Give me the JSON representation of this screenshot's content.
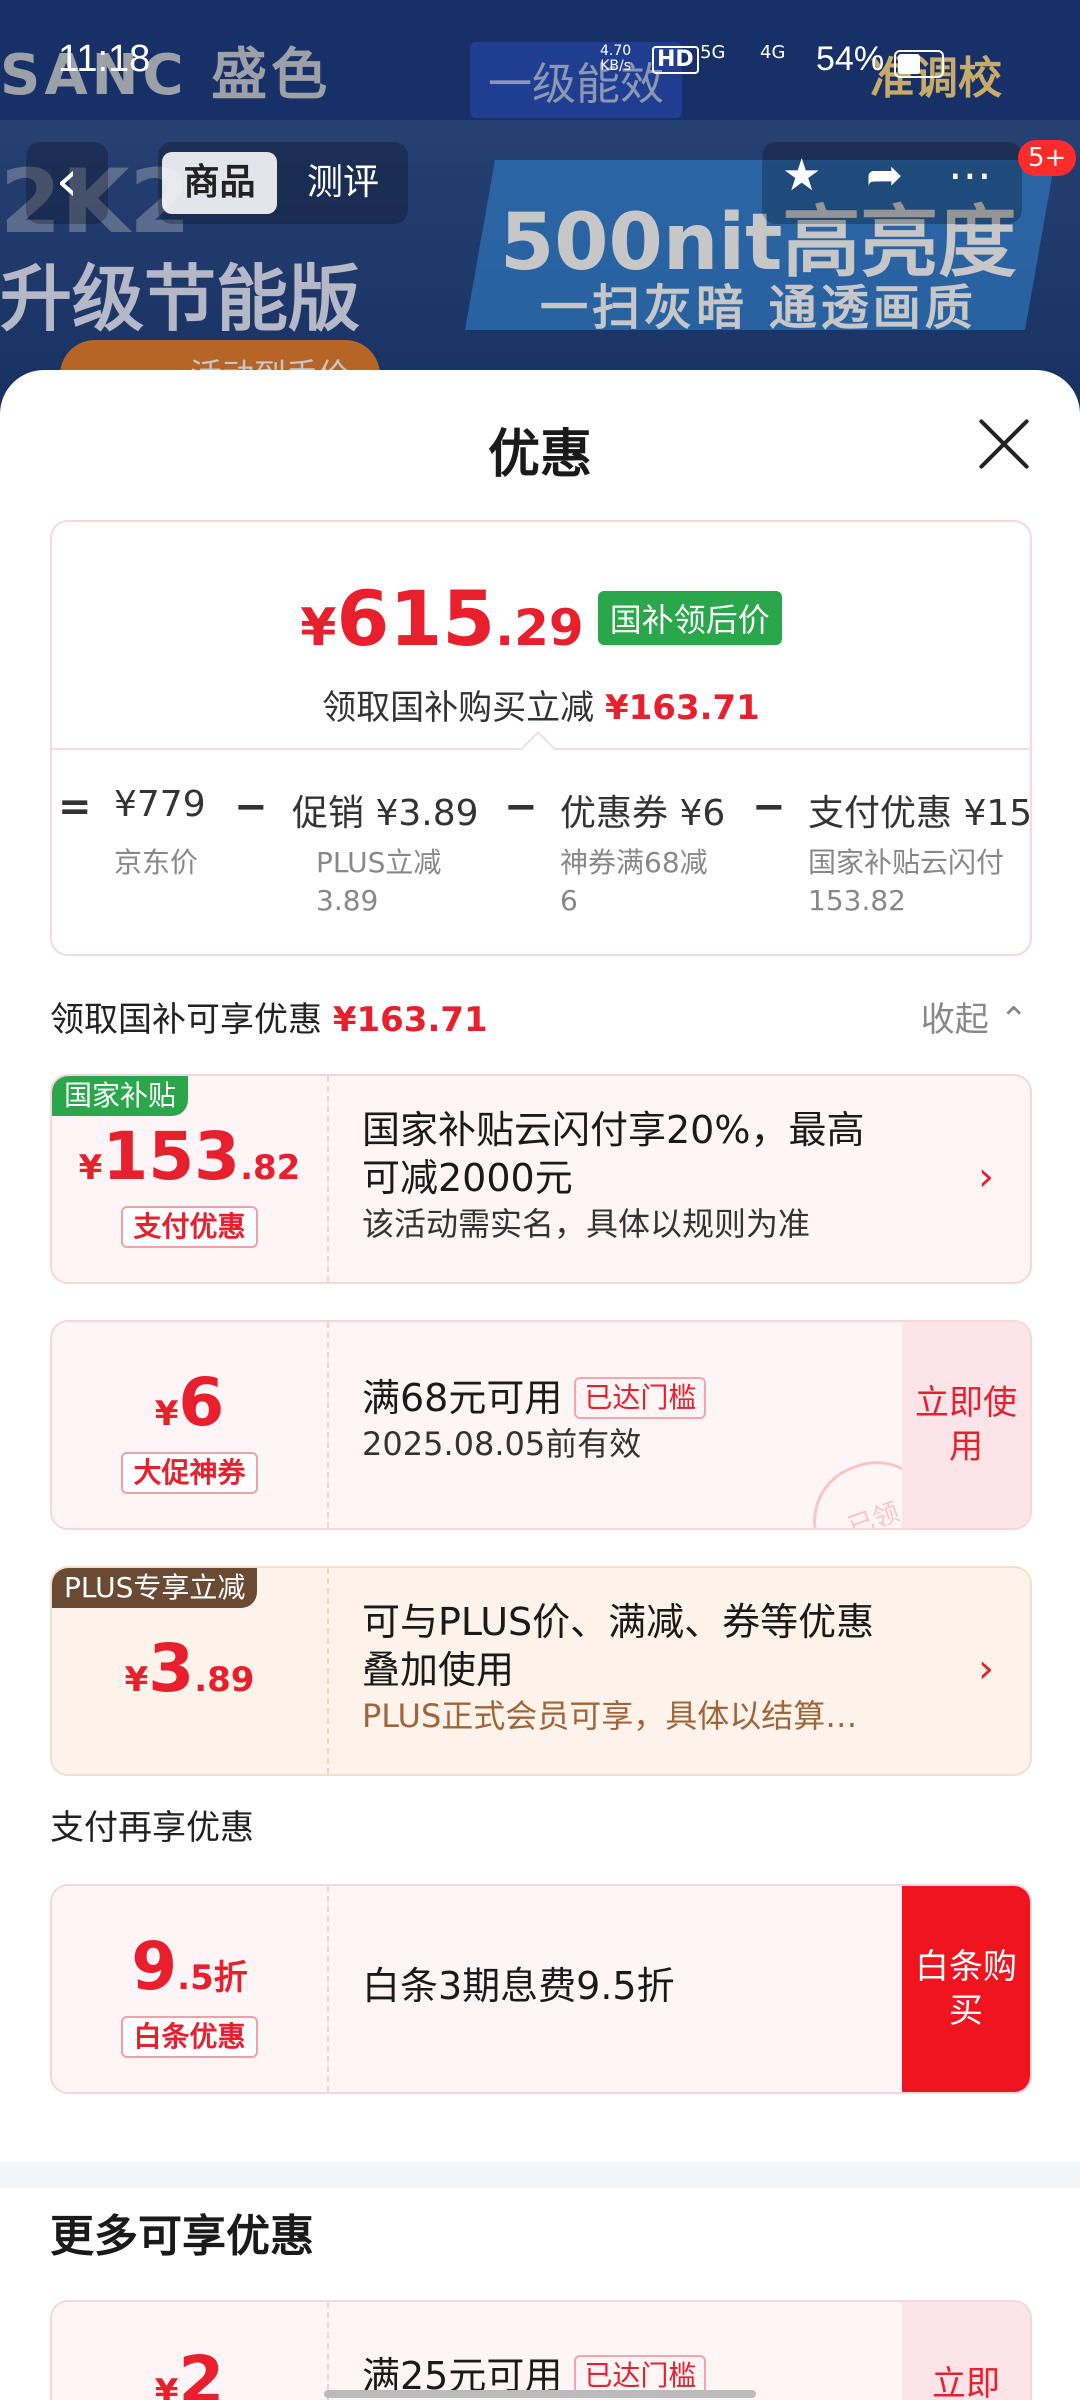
{
  "status_bar": {
    "time": "11:18",
    "net_speed": "4.70",
    "net_unit": "KB/s",
    "hd": "HD",
    "signal1": "5G",
    "signal2": "4G",
    "battery": "54%"
  },
  "banner": {
    "brand": "SANC 盛色",
    "tag_energy": "一级能效",
    "tag_calib": "准调校",
    "left_text": "2K2",
    "left_text2": "升级节能版",
    "right_text": "500nit高亮度",
    "right_text2": "一扫灰暗 通透画质",
    "promo": "活动到手价"
  },
  "nav": {
    "back_icon": "‹",
    "tab_active": "商品",
    "tab_other": "测评",
    "badge": "5+"
  },
  "sheet": {
    "title": "优惠",
    "price": {
      "currency": "¥",
      "integer": "615",
      "decimal": ".29",
      "tag": "国补领后价",
      "subtitle": "领取国补购买立减",
      "subtitle_amount": "¥163.71"
    },
    "calc": {
      "eq": "=",
      "items": [
        {
          "value": "¥779",
          "label": "京东价",
          "label2": ""
        },
        {
          "value": "促销 ¥3.89",
          "label": "PLUS立减",
          "label2": "3.89"
        },
        {
          "value": "优惠券 ¥6",
          "label": "神券满68减",
          "label2": "6"
        },
        {
          "value": "支付优惠 ¥15",
          "label": "国家补贴云闪付",
          "label2": "153.82"
        }
      ],
      "op": "−"
    },
    "section1": {
      "label": "领取国补可享优惠",
      "amount": "¥163.71",
      "collapse": "收起 ⌃"
    },
    "cards": [
      {
        "corner_tag": "国家补贴",
        "currency": "¥",
        "integer": "153",
        "decimal": ".82",
        "tag": "支付优惠",
        "line1": "国家补贴云闪付享20%，最高",
        "line2": "可减2000元",
        "line3": "该活动需实名，具体以规则为准",
        "arrow": "›"
      },
      {
        "currency": "¥",
        "integer": "6",
        "tag": "大促神券",
        "line1": "满68元可用",
        "threshold": "已达门槛",
        "line2": "2025.08.05前有效",
        "button": "立即使用",
        "stamp": "已领"
      },
      {
        "corner_tag": "PLUS专享立减",
        "currency": "¥",
        "integer": "3",
        "decimal": ".89",
        "line1": "可与PLUS价、满减、券等优惠",
        "line2": "叠加使用",
        "line3": "PLUS正式会员可享，具体以结算…",
        "arrow": "›"
      }
    ],
    "section2": {
      "label": "支付再享优惠"
    },
    "pay_card": {
      "integer": "9",
      "decimal": ".5折",
      "tag": "白条优惠",
      "line1": "白条3期息费9.5折",
      "button": "白条购买"
    },
    "more": {
      "title": "更多可享优惠",
      "card": {
        "currency": "¥",
        "integer": "2",
        "line1": "满25元可用",
        "threshold": "已达门槛",
        "button": "立即"
      }
    }
  },
  "colors": {
    "accent_red": "#e8202e",
    "green_tag": "#2aa64b",
    "plus_tag": "#6b4a33"
  }
}
